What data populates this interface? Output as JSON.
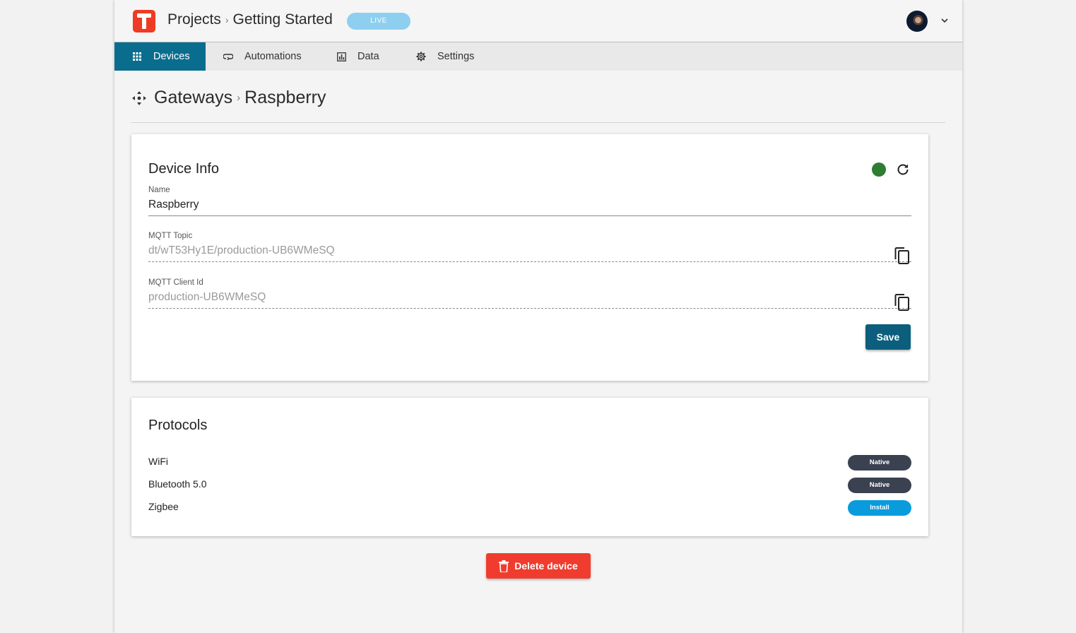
{
  "header": {
    "logo_icon": "tinkerthing-logo-icon",
    "breadcrumb": [
      "Projects",
      "Getting Started"
    ],
    "breadcrumb_separator": "›",
    "env_badge": "LIVE",
    "colors": {
      "brand": "#ee3b23",
      "badge": "#8ecff0"
    }
  },
  "nav": {
    "items": [
      {
        "label": "Devices",
        "icon": "grid-icon",
        "active": true
      },
      {
        "label": "Automations",
        "icon": "loop-icon",
        "active": false
      },
      {
        "label": "Data",
        "icon": "bar-chart-icon",
        "active": false
      },
      {
        "label": "Settings",
        "icon": "gear-icon",
        "active": false
      }
    ],
    "active_color": "#0b6d8d"
  },
  "page": {
    "icon": "move-arrows-icon",
    "breadcrumb": [
      "Gateways",
      "Raspberry"
    ],
    "separator": "›"
  },
  "device_info": {
    "title": "Device Info",
    "status": "online",
    "status_color": "#2e7d32",
    "fields": {
      "name": {
        "label": "Name",
        "value": "Raspberry"
      },
      "mqtt_topic": {
        "label": "MQTT Topic",
        "value": "dt/wT53Hy1E/production-UB6WMeSQ"
      },
      "mqtt_client_id": {
        "label": "MQTT Client Id",
        "value": "production-UB6WMeSQ"
      }
    },
    "save_label": "Save"
  },
  "protocols": {
    "title": "Protocols",
    "items": [
      {
        "name": "WiFi",
        "action": "Native"
      },
      {
        "name": "Bluetooth 5.0",
        "action": "Native"
      },
      {
        "name": "Zigbee",
        "action": "Install"
      }
    ]
  },
  "delete_label": "Delete device",
  "sep": "›"
}
